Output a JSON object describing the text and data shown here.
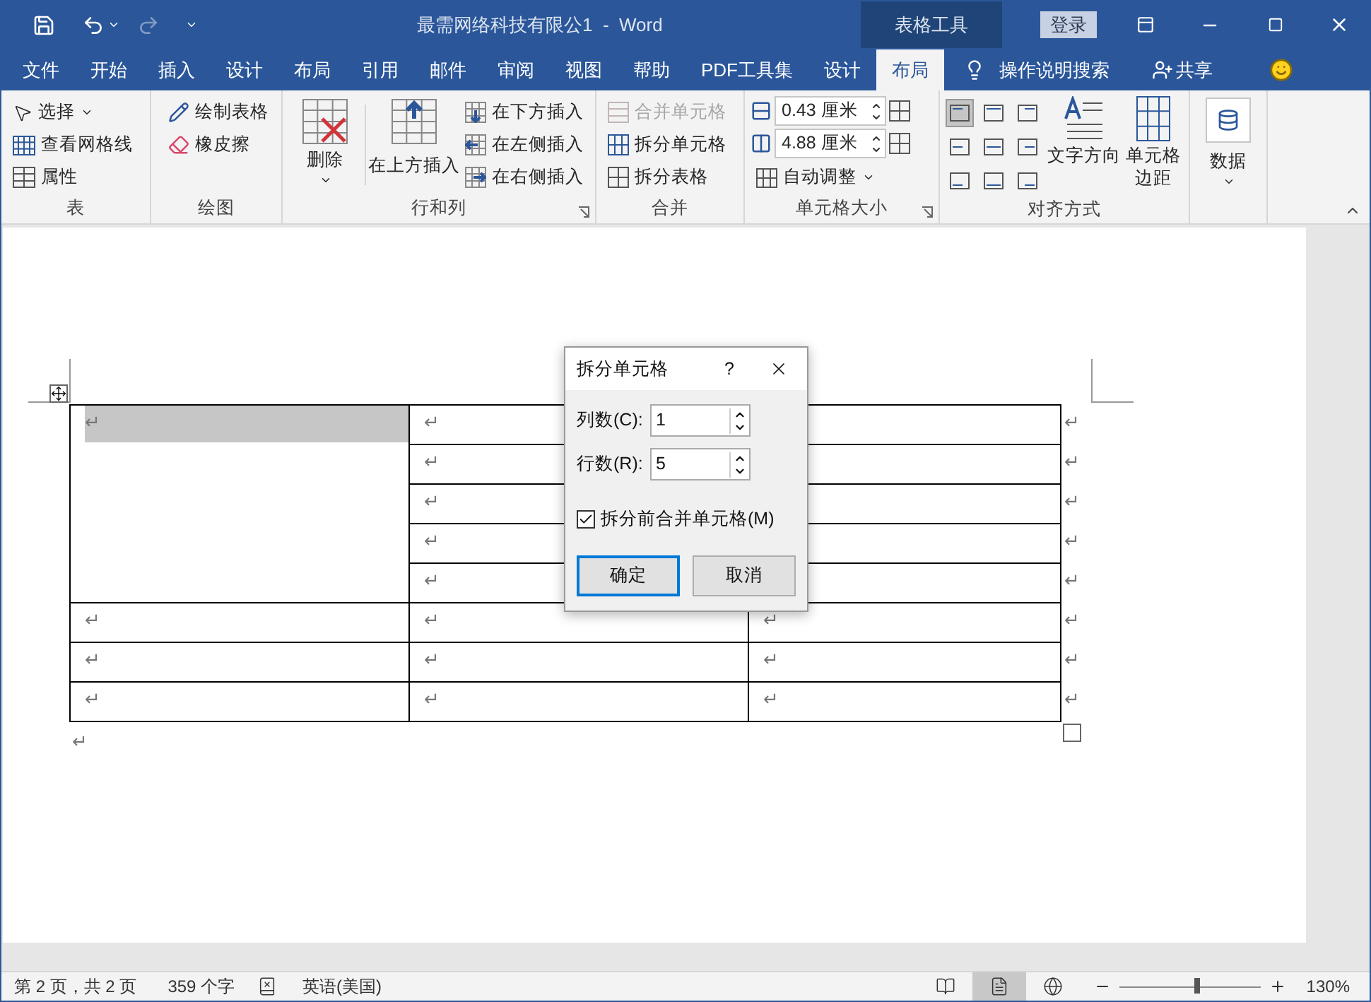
{
  "quick_access_toolbar": {
    "redo_disabled": true
  },
  "window": {
    "title": "最需网络科技有限公1  -  Word",
    "context_header": "表格工具",
    "sign_in": "登录"
  },
  "tabs": [
    {
      "label": "文件",
      "selected": false
    },
    {
      "label": "开始",
      "selected": false
    },
    {
      "label": "插入",
      "selected": false
    },
    {
      "label": "设计",
      "selected": false
    },
    {
      "label": "布局",
      "selected": false
    },
    {
      "label": "引用",
      "selected": false
    },
    {
      "label": "邮件",
      "selected": false
    },
    {
      "label": "审阅",
      "selected": false
    },
    {
      "label": "视图",
      "selected": false
    },
    {
      "label": "帮助",
      "selected": false
    },
    {
      "label": "PDF工具集",
      "selected": false
    },
    {
      "label": "设计",
      "selected": false
    },
    {
      "label": "布局",
      "selected": true
    }
  ],
  "tell_me": "操作说明搜索",
  "share": "共享",
  "ribbon": {
    "table_group": {
      "label": "表",
      "select": "选择",
      "view_gridlines": "查看网格线",
      "properties": "属性"
    },
    "draw_group": {
      "label": "绘图",
      "draw_table": "绘制表格",
      "eraser": "橡皮擦"
    },
    "rows_columns_group": {
      "label": "行和列",
      "delete": "删除",
      "insert_above": "在上方插入",
      "insert_below": "在下方插入",
      "insert_left": "在左侧插入",
      "insert_right": "在右侧插入"
    },
    "merge_group": {
      "label": "合并",
      "merge_cells": {
        "label": "合并单元格",
        "disabled": true
      },
      "split_cells": "拆分单元格",
      "split_table": "拆分表格"
    },
    "cell_size_group": {
      "label": "单元格大小",
      "height": "0.43 厘米",
      "width": "4.88 厘米",
      "autofit": "自动调整"
    },
    "alignment_group": {
      "label": "对齐方式",
      "alignment_buttons": [
        {
          "selected": true
        },
        {
          "selected": false
        },
        {
          "selected": false
        },
        {
          "selected": false
        },
        {
          "selected": false
        },
        {
          "selected": false
        },
        {
          "selected": false
        },
        {
          "selected": false
        },
        {
          "selected": false
        }
      ],
      "text_direction": "文字方向",
      "cell_margins": "单元格边距"
    },
    "data_group": {
      "data": "数据"
    }
  },
  "table": {
    "merged_cell": {
      "mark": "↵",
      "selected": true
    },
    "rows": [
      {
        "cells": [
          {
            "mark": "↵"
          },
          {}
        ],
        "end_mark": "↵"
      },
      {
        "cells": [
          {
            "mark": "↵"
          },
          {}
        ],
        "end_mark": "↵"
      },
      {
        "cells": [
          {
            "mark": "↵"
          },
          {}
        ],
        "end_mark": "↵"
      },
      {
        "cells": [
          {
            "mark": "↵"
          },
          {}
        ],
        "end_mark": "↵"
      },
      {
        "cells": [
          {
            "mark": "↵"
          },
          {}
        ],
        "end_mark": "↵"
      },
      {
        "cells": [
          {
            "mark": "↵"
          },
          {
            "mark": "↵"
          },
          {
            "mark": "↵"
          }
        ],
        "end_mark": "↵"
      },
      {
        "cells": [
          {
            "mark": "↵"
          },
          {
            "mark": "↵"
          },
          {
            "mark": "↵"
          }
        ],
        "end_mark": "↵"
      },
      {
        "cells": [
          {
            "mark": "↵"
          },
          {
            "mark": "↵"
          },
          {
            "mark": "↵"
          }
        ],
        "end_mark": "↵"
      }
    ]
  },
  "paragraph_mark": "↵",
  "dialog": {
    "title": "拆分单元格",
    "help": "?",
    "fields": [
      {
        "label": "列数(C):",
        "value": "1"
      },
      {
        "label": "行数(R):",
        "value": "5"
      }
    ],
    "checkbox": {
      "label": "拆分前合并单元格(M)",
      "checked": true
    },
    "buttons": [
      {
        "label": "确定",
        "default": true
      },
      {
        "label": "取消",
        "default": false
      }
    ]
  },
  "status_bar": {
    "page": "第 2 页，共 2 页",
    "words": "359 个字",
    "language": "英语(美国)",
    "views": [
      {
        "selected": false
      },
      {
        "selected": true
      },
      {
        "selected": false
      }
    ],
    "zoom_slider": {
      "level": 0.55
    },
    "zoom": "130%"
  }
}
